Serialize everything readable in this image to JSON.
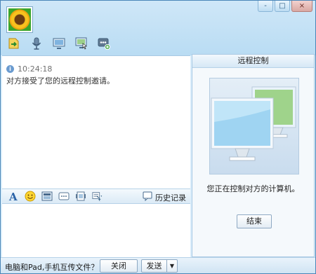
{
  "window": {
    "controls": [
      "-",
      "□",
      "×"
    ]
  },
  "toolbar": {
    "icons": [
      "send-file-icon",
      "voice-icon",
      "video-icon",
      "remote-control-icon",
      "app-more-icon"
    ]
  },
  "chat": {
    "messages": [
      {
        "time": "10:24:18",
        "text": "对方接受了您的远程控制邀请。"
      }
    ]
  },
  "input_toolbar": {
    "icons": [
      "font-icon",
      "emoji-icon",
      "screenshot-icon",
      "shake-icon",
      "image-icon",
      "music-icon"
    ],
    "history_label": "历史记录"
  },
  "remote_panel": {
    "title": "远程控制",
    "status": "您正在控制对方的计算机。",
    "end_label": "结束"
  },
  "bottom": {
    "promo": "电脑和Pad,手机互传文件？",
    "close_label": "关闭",
    "send_label": "发送",
    "send_arrow": "▼"
  }
}
